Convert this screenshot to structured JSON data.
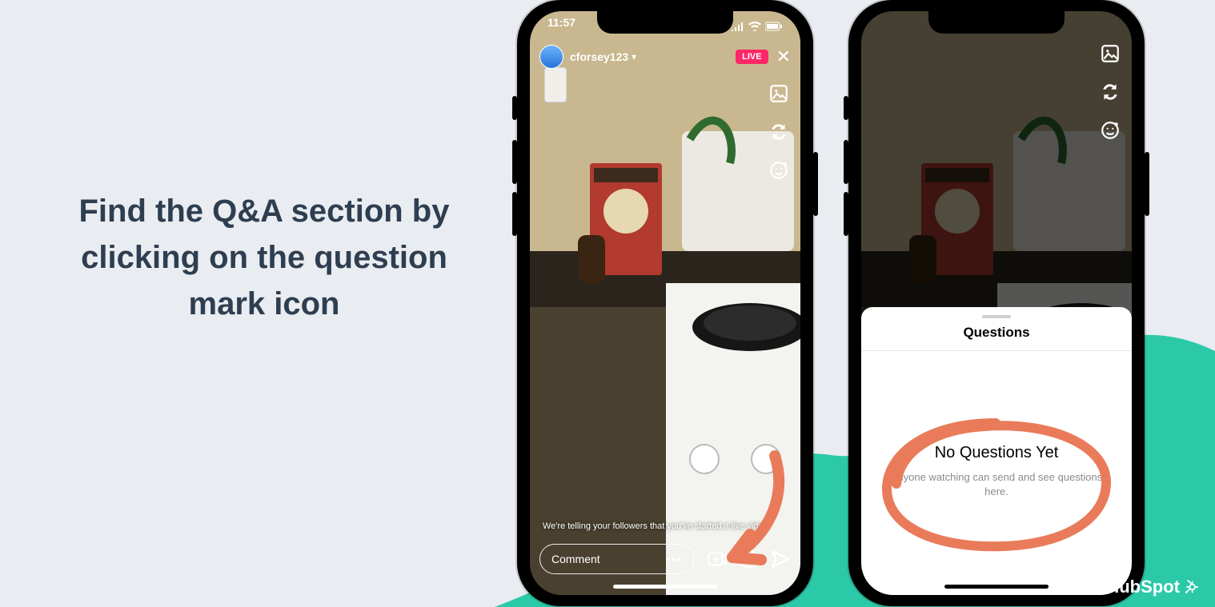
{
  "headline": "Find the Q&A section by clicking on the question mark icon",
  "brand": "HubSpot",
  "annotation_color": "#E97B5A",
  "phone1": {
    "status": {
      "time": "11:57"
    },
    "header": {
      "username": "cforsey123",
      "live_label": "LIVE"
    },
    "tip_text": "We're telling your followers that you've started a live video.",
    "comment_placeholder": "Comment",
    "comment_more": "•••"
  },
  "phone2": {
    "drawer": {
      "title": "Questions",
      "empty": "No Questions Yet",
      "subtitle": "Anyone watching can send and see questions here."
    }
  }
}
